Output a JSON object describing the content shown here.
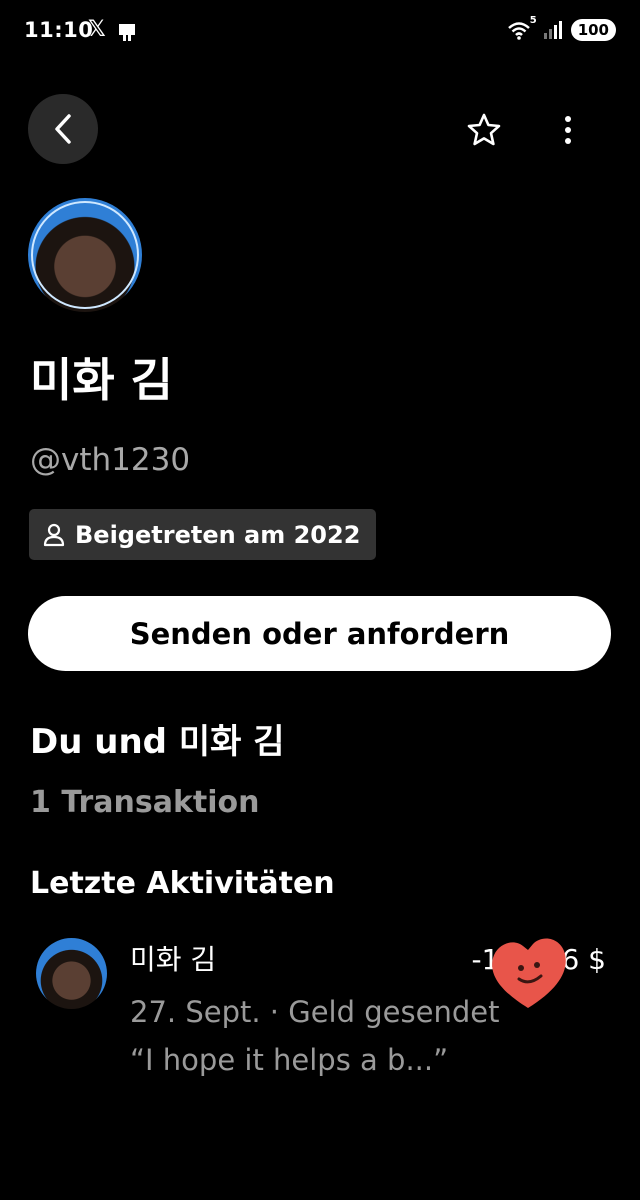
{
  "status_bar": {
    "time": "11:10",
    "x_logo": "𝕏",
    "wifi_badge": "5",
    "battery": "100"
  },
  "header": {
    "back_icon": "chevron-left-icon",
    "favorite_icon": "star-outline-icon",
    "more_icon": "more-vertical-icon"
  },
  "profile": {
    "name": "미화 김",
    "username": "@vth1230",
    "joined_badge": "Beigetreten am 2022"
  },
  "actions": {
    "send_or_request": "Senden oder anfordern"
  },
  "shared": {
    "title": "Du und 미화 김",
    "transaction_count": "1 Transaktion"
  },
  "recent": {
    "title": "Letzte Aktivitäten",
    "items": [
      {
        "name": "미화 김",
        "amount": "-1",
        "amount_suffix": "6 $",
        "meta": "27. Sept. · Geld gesendet",
        "note": "“I hope it helps a b...”"
      }
    ]
  },
  "colors": {
    "background": "#000000",
    "badge_bg": "#333333",
    "muted_text": "#9a9a9a",
    "sticker": "#e8554a"
  }
}
